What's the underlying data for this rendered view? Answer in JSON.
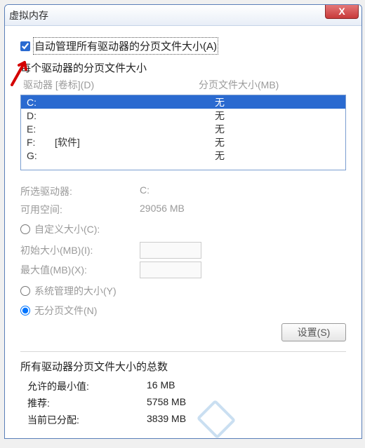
{
  "window": {
    "title": "虚拟内存",
    "close_icon": "X"
  },
  "autoManage": {
    "label": "自动管理所有驱动器的分页文件大小(A)",
    "checked": true
  },
  "perDrive": {
    "title": "每个驱动器的分页文件大小",
    "colDrive": "驱动器 [卷标](D)",
    "colPage": "分页文件大小(MB)",
    "rows": [
      {
        "drive": "C:",
        "label": "",
        "page": "无",
        "selected": true
      },
      {
        "drive": "D:",
        "label": "",
        "page": "无",
        "selected": false
      },
      {
        "drive": "E:",
        "label": "",
        "page": "无",
        "selected": false
      },
      {
        "drive": "F:",
        "label": "[软件]",
        "page": "无",
        "selected": false
      },
      {
        "drive": "G:",
        "label": "",
        "page": "无",
        "selected": false
      }
    ]
  },
  "selected": {
    "driveLabel": "所选驱动器:",
    "driveValue": "C:",
    "freeLabel": "可用空间:",
    "freeValue": "29056 MB"
  },
  "custom": {
    "radioLabel": "自定义大小(C):",
    "initLabel": "初始大小(MB)(I):",
    "initValue": "",
    "maxLabel": "最大值(MB)(X):",
    "maxValue": ""
  },
  "systemManaged": {
    "label": "系统管理的大小(Y)"
  },
  "noPage": {
    "label": "无分页文件(N)",
    "checked": true
  },
  "setButton": "设置(S)",
  "totals": {
    "title": "所有驱动器分页文件大小的总数",
    "minLabel": "允许的最小值:",
    "minValue": "16 MB",
    "recLabel": "推荐:",
    "recValue": "5758 MB",
    "curLabel": "当前已分配:",
    "curValue": "3839 MB"
  }
}
